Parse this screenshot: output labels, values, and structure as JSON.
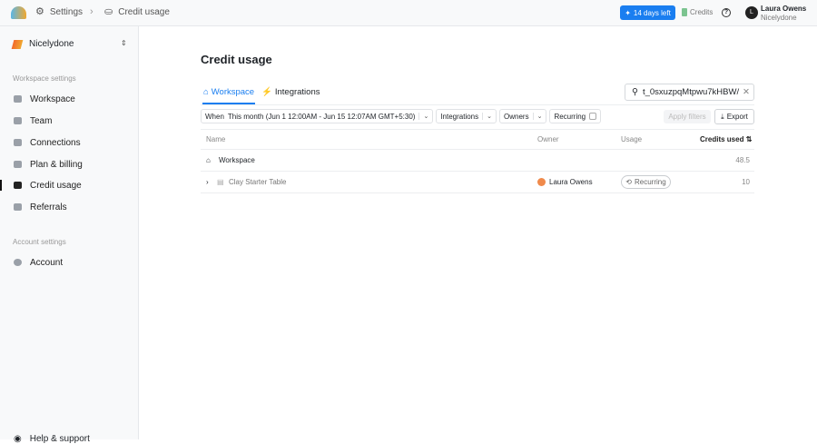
{
  "topbar": {
    "breadcrumb": [
      "Settings",
      "Credit usage"
    ],
    "trial": "14 days left",
    "credits": "Credits",
    "user": {
      "initial": "L",
      "name": "Laura Owens",
      "org": "Nicelydone"
    }
  },
  "sidebar": {
    "workspace": "Nicelydone",
    "workspace_section": "Workspace settings",
    "items": [
      {
        "label": "Workspace"
      },
      {
        "label": "Team"
      },
      {
        "label": "Connections"
      },
      {
        "label": "Plan & billing"
      },
      {
        "label": "Credit usage"
      },
      {
        "label": "Referrals"
      }
    ],
    "account_section": "Account settings",
    "account_items": [
      {
        "label": "Account"
      }
    ],
    "help": "Help & support"
  },
  "main": {
    "title": "Credit usage",
    "tabs": [
      {
        "label": "Workspace"
      },
      {
        "label": "Integrations"
      }
    ],
    "search": {
      "value": "t_0sxuzpqMtpwu7kHBW/"
    },
    "filters": {
      "when_label": "When",
      "when_value": "This month (Jun 1 12:00AM - Jun 15 12:07AM GMT+5:30)",
      "integrations": "Integrations",
      "owners": "Owners",
      "recurring": "Recurring",
      "apply": "Apply filters",
      "export": "Export"
    },
    "table": {
      "headers": [
        "Name",
        "Owner",
        "Usage",
        "Credits used"
      ],
      "rows": [
        {
          "name": "Workspace",
          "owner": "",
          "usage": "",
          "credits": "48.5"
        },
        {
          "name": "Clay Starter Table",
          "owner": "Laura Owens",
          "usage": "Recurring",
          "credits": "10"
        }
      ]
    }
  }
}
